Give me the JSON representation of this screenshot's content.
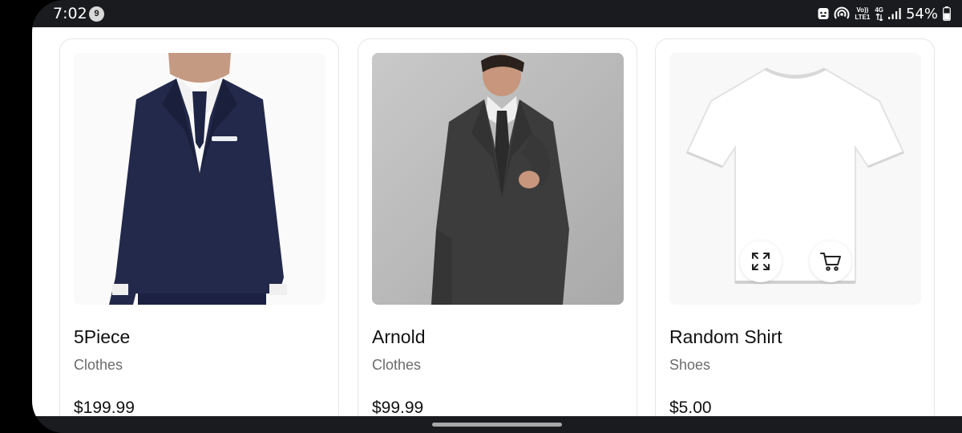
{
  "status_bar": {
    "time": "7:02",
    "notification_count": "9",
    "volte_label": "Vo))",
    "lte_label": "LTE1",
    "network_label": "4G",
    "battery": "54%"
  },
  "products": [
    {
      "title": "5Piece",
      "category": "Clothes",
      "price": "$199.99",
      "image": "navy-three-piece-suit"
    },
    {
      "title": "Arnold",
      "category": "Clothes",
      "price": "$99.99",
      "image": "man-in-grey-suit"
    },
    {
      "title": "Random Shirt",
      "category": "Shoes",
      "price": "$5.00",
      "image": "white-t-shirt"
    }
  ],
  "card_actions": {
    "expand_icon": "expand-icon",
    "cart_icon": "cart-icon"
  },
  "colors": {
    "status_bar": "#1a1b1e",
    "background": "#ffffff",
    "card_border": "#e6e6e6",
    "text": "#111111",
    "muted_text": "#6b6b6b"
  }
}
